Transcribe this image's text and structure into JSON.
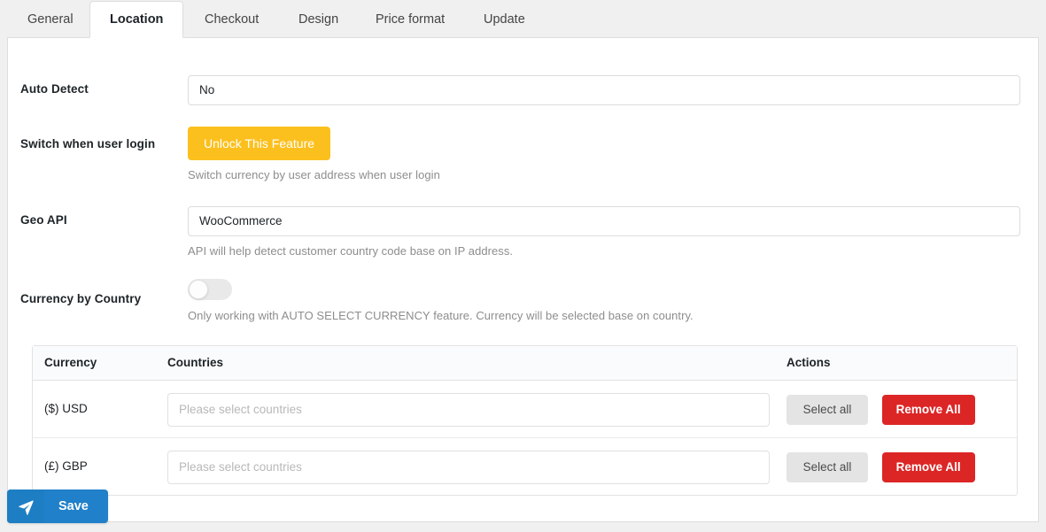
{
  "tabs": [
    {
      "label": "General",
      "active": false
    },
    {
      "label": "Location",
      "active": true
    },
    {
      "label": "Checkout",
      "active": false
    },
    {
      "label": "Design",
      "active": false
    },
    {
      "label": "Price format",
      "active": false
    },
    {
      "label": "Update",
      "active": false
    }
  ],
  "form": {
    "auto_detect": {
      "label": "Auto Detect",
      "value": "No"
    },
    "switch_on_login": {
      "label": "Switch when user login",
      "button_label": "Unlock This Feature",
      "helper": "Switch currency by user address when user login"
    },
    "geo_api": {
      "label": "Geo API",
      "value": "WooCommerce",
      "helper": "API will help detect customer country code base on IP address."
    },
    "currency_by_country": {
      "label": "Currency by Country",
      "toggle_state": "off",
      "helper": "Only working with AUTO SELECT CURRENCY feature. Currency will be selected base on country."
    }
  },
  "table": {
    "headers": {
      "currency": "Currency",
      "countries": "Countries",
      "actions": "Actions"
    },
    "rows": [
      {
        "currency": "($) USD",
        "countries_placeholder": "Please select countries",
        "select_all_label": "Select all",
        "remove_all_label": "Remove All"
      },
      {
        "currency": "(£) GBP",
        "countries_placeholder": "Please select countries",
        "select_all_label": "Select all",
        "remove_all_label": "Remove All"
      }
    ]
  },
  "footer": {
    "save_label": "Save",
    "save_icon": "paper-plane-icon"
  },
  "colors": {
    "unlock_button": "#fcc01e",
    "remove_all_button": "#dc2626",
    "select_all_button": "#e4e4e4",
    "save_button": "#2080c9",
    "page_background": "#f0f0f0",
    "panel_background": "#ffffff"
  }
}
